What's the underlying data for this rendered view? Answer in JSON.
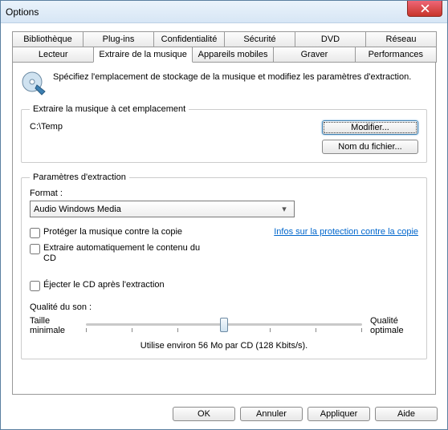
{
  "window": {
    "title": "Options"
  },
  "tabs_row1": [
    "Bibliothèque",
    "Plug-ins",
    "Confidentialité",
    "Sécurité",
    "DVD",
    "Réseau"
  ],
  "tabs_row2": [
    "Lecteur",
    "Extraire de la musique",
    "Appareils mobiles",
    "Graver",
    "Performances"
  ],
  "active_tab": "Extraire de la musique",
  "intro": "Spécifiez l'emplacement de stockage de la musique et modifiez les paramètres d'extraction.",
  "group_location": {
    "legend": "Extraire la musique à cet emplacement",
    "path": "C:\\Temp",
    "btn_modify": "Modifier...",
    "btn_filename": "Nom du fichier..."
  },
  "group_params": {
    "legend": "Paramètres d'extraction",
    "format_label": "Format :",
    "format_value": "Audio Windows Media",
    "chk_protect": "Protéger la musique contre la copie",
    "link_protection": "Infos sur la protection contre la copie",
    "chk_auto": "Extraire automatiquement le contenu du CD",
    "chk_eject": "Éjecter le CD après l'extraction",
    "quality_label": "Qualité du son :",
    "slider_min": "Taille minimale",
    "slider_max": "Qualité optimale",
    "usage": "Utilise environ 56 Mo par CD (128 Kbits/s)."
  },
  "buttons": {
    "ok": "OK",
    "cancel": "Annuler",
    "apply": "Appliquer",
    "help": "Aide"
  }
}
